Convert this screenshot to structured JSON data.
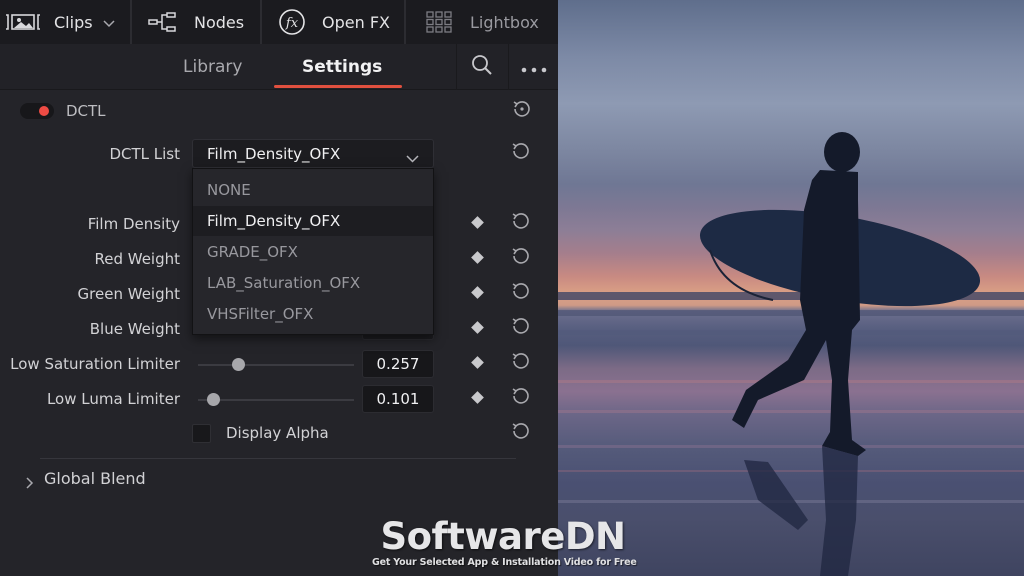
{
  "topbar": {
    "items": [
      {
        "label": "Clips",
        "icon": "clips-icon",
        "has_dropdown": true
      },
      {
        "label": "Nodes",
        "icon": "nodes-icon"
      },
      {
        "label": "Open FX",
        "icon": "fx-icon"
      },
      {
        "label": "Lightbox",
        "icon": "grid-icon"
      }
    ]
  },
  "tabs": {
    "items": [
      {
        "label": "Library",
        "active": false
      },
      {
        "label": "Settings",
        "active": true
      }
    ],
    "accent_color": "#e0503f"
  },
  "dctl": {
    "enabled": true,
    "label": "DCTL",
    "toggle_color": "#ee4b44",
    "list_label": "DCTL List",
    "list_value": "Film_Density_OFX",
    "dropdown_open": true,
    "options": [
      {
        "label": "NONE",
        "selected": false
      },
      {
        "label": "Film_Density_OFX",
        "selected": true
      },
      {
        "label": "GRADE_OFX",
        "selected": false
      },
      {
        "label": "LAB_Saturation_OFX",
        "selected": false
      },
      {
        "label": "VHSFilter_OFX",
        "selected": false
      }
    ]
  },
  "params": [
    {
      "label": "Film Density"
    },
    {
      "label": "Red Weight"
    },
    {
      "label": "Green Weight"
    },
    {
      "label": "Blue Weight"
    },
    {
      "label": "Low Saturation Limiter",
      "value": "0.257",
      "slider_fraction": 0.257
    },
    {
      "label": "Low Luma Limiter",
      "value": "0.101",
      "slider_fraction": 0.101
    }
  ],
  "display_alpha": {
    "label": "Display Alpha",
    "checked": false
  },
  "global_blend": {
    "label": "Global Blend",
    "expanded": false
  },
  "watermark": {
    "title": "SoftwareDN",
    "subtitle": "Get Your Selected App & Installation Video for Free"
  }
}
